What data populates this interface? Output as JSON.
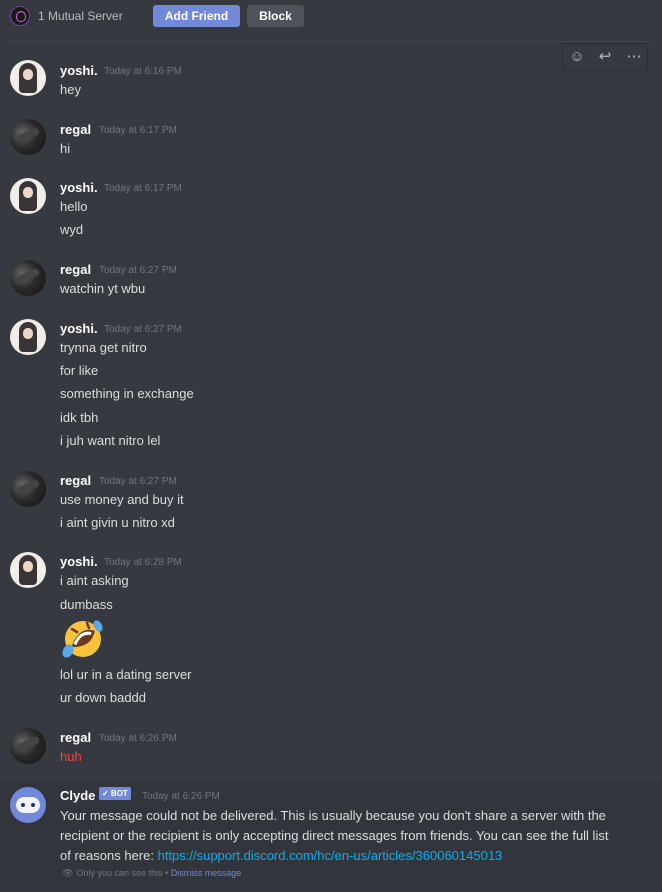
{
  "header": {
    "mutual_server": "1 Mutual Server",
    "add_friend": "Add Friend",
    "block": "Block"
  },
  "messages": [
    {
      "author": "yoshi.",
      "timestamp": "Today at 6:16 PM",
      "lines": [
        "hey"
      ]
    },
    {
      "author": "regal",
      "timestamp": "Today at 6:17 PM",
      "lines": [
        "hi"
      ]
    },
    {
      "author": "yoshi.",
      "timestamp": "Today at 6:17 PM",
      "lines": [
        "hello",
        "wyd"
      ]
    },
    {
      "author": "regal",
      "timestamp": "Today at 6:27 PM",
      "lines": [
        "watchin yt wbu"
      ]
    },
    {
      "author": "yoshi.",
      "timestamp": "Today at 6:27 PM",
      "lines": [
        "trynna get nitro",
        "for like",
        "something in exchange",
        "idk tbh",
        "i juh want nitro lel"
      ]
    },
    {
      "author": "regal",
      "timestamp": "Today at 6:27 PM",
      "lines": [
        "use money and buy it",
        "i aint givin u nitro xd"
      ]
    },
    {
      "author": "yoshi.",
      "timestamp": "Today at 6:28 PM",
      "lines": [
        "i aint asking",
        "dumbass",
        "lol ur in a dating server",
        "ur down baddd"
      ],
      "emoji": "rolling-on-the-floor-laughing"
    },
    {
      "author": "regal",
      "timestamp": "Today at 6:26 PM",
      "lines": [
        "huh"
      ]
    }
  ],
  "clyde": {
    "author": "Clyde",
    "tag": "✓ BOT",
    "timestamp": "Today at 6:26 PM",
    "text": "Your message could not be delivered. This is usually because you don't share a server with the recipient or the recipient is only accepting direct messages from friends. You can see the full list of reasons here:",
    "link": "https://support.discord.com/hc/en-us/articles/360060145013",
    "only_you": "Only you can see this •",
    "dismiss": "Dismiss message"
  },
  "colors": {
    "background": "#36393f",
    "accent": "#7289da",
    "link": "#00b0f4",
    "error_text": "#f04747"
  }
}
